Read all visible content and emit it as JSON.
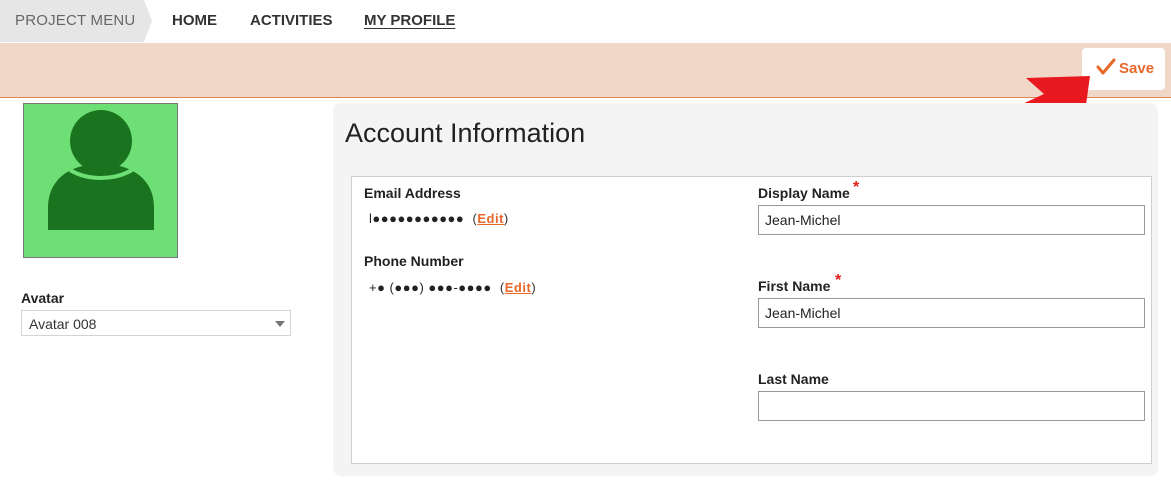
{
  "nav": {
    "project_menu": "PROJECT MENU",
    "items": [
      {
        "label": "HOME"
      },
      {
        "label": "ACTIVITIES"
      },
      {
        "label": "MY PROFILE"
      }
    ]
  },
  "toolbar": {
    "save_label": "Save",
    "save_icon": "checkmark-icon"
  },
  "avatar": {
    "label": "Avatar",
    "selected": "Avatar 008",
    "icon": "user-silhouette-icon"
  },
  "account": {
    "title": "Account Information",
    "email": {
      "label": "Email Address",
      "masked_value": "l●●●●●●●●●●●",
      "edit_label": "Edit"
    },
    "phone": {
      "label": "Phone Number",
      "masked_value": "+● (●●●) ●●●-●●●●",
      "edit_label": "Edit"
    },
    "display_name": {
      "label": "Display Name",
      "required_mark": "*",
      "value": "Jean-Michel"
    },
    "first_name": {
      "label": "First Name",
      "required_mark": "*",
      "value": "Jean-Michel"
    },
    "last_name": {
      "label": "Last Name",
      "value": ""
    }
  },
  "colors": {
    "accent": "#e8682a",
    "toolbar_bg": "#f0d7c8",
    "avatar_bg": "#6ddf74",
    "avatar_fg": "#1a731f",
    "required": "#e01a1a"
  }
}
